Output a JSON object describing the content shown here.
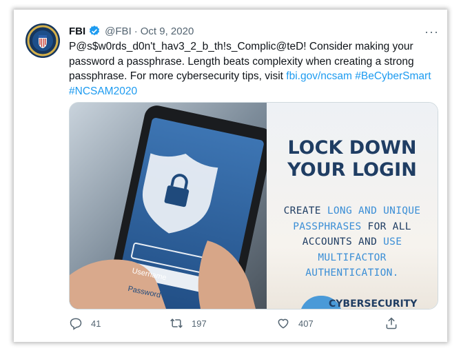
{
  "tweet": {
    "author_name": "FBI",
    "handle": "@FBI",
    "separator": "·",
    "date": "Oct 9, 2020",
    "more_label": "···",
    "text_line1": "P@s$w0rds_d0n't_hav3_2_b_th!s_Complic@teD! Consider making your password a passphrase. Length beats complexity when creating a strong passphrase. For more cybersecurity tips, visit ",
    "link_url_text": "fbi.gov/ncsam",
    "hashtag1": "#BeCyberSmart",
    "hashtag2": "#NCSAM2020"
  },
  "media": {
    "headline_line1": "LOCK DOWN",
    "headline_line2": "YOUR LOGIN",
    "sub_1": "CREATE ",
    "sub_2": "LONG AND UNIQUE",
    "sub_3": "PASSPHRASES",
    "sub_4": " FOR ALL",
    "sub_5": "ACCOUNTS AND ",
    "sub_6": "USE",
    "sub_7": "MULTIFACTOR",
    "sub_8": "AUTHENTICATION.",
    "brand_text": "CYBERSECURITY",
    "phone_field1": "Username",
    "phone_field2": "Password"
  },
  "actions": {
    "reply_count": "41",
    "retweet_count": "197",
    "like_count": "407"
  },
  "colors": {
    "link": "#1d9bf0",
    "headline": "#1f3d63",
    "accent": "#3a8ed6"
  }
}
